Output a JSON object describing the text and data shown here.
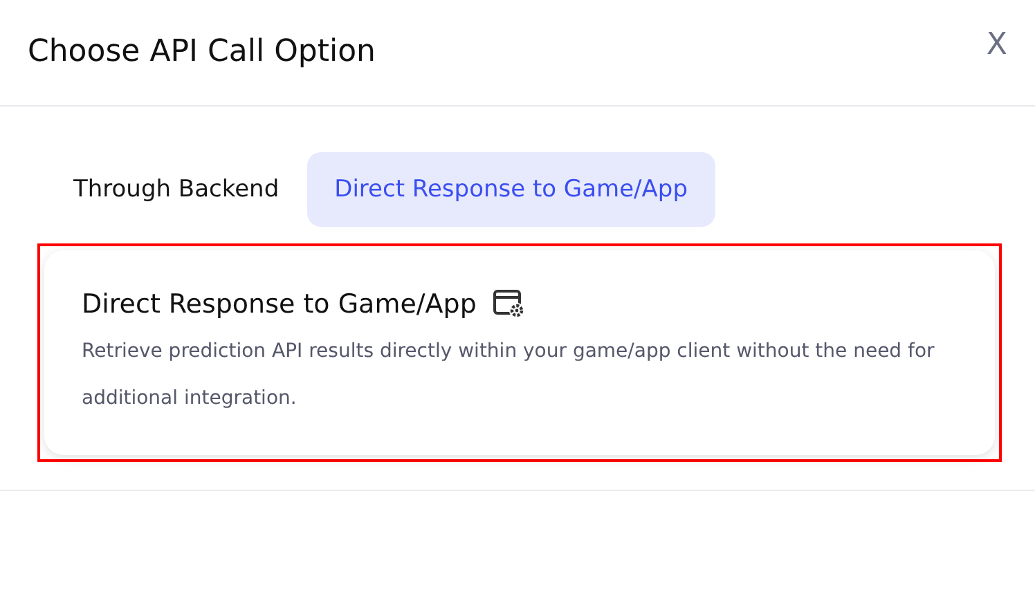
{
  "dialog": {
    "title": "Choose API Call Option",
    "close": "X"
  },
  "tabs": [
    {
      "label": "Through Backend",
      "selected": false
    },
    {
      "label": "Direct Response to Game/App",
      "selected": true
    }
  ],
  "card": {
    "title": "Direct Response to Game/App",
    "description": "Retrieve prediction API results directly within your game/app client without the need for additional integration.",
    "highlighted": true
  }
}
